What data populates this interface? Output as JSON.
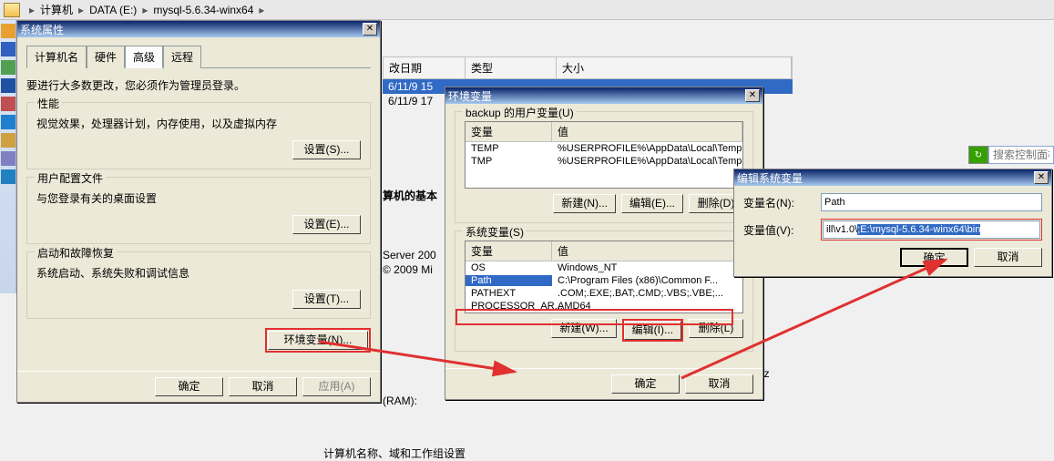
{
  "breadcrumb": {
    "parts": [
      "计算机",
      "DATA (E:)",
      "mysql-5.6.34-winx64"
    ],
    "arrow": "▸"
  },
  "search": {
    "placeholder": "搜索控制面板"
  },
  "bg": {
    "hdr_date": "改日期",
    "hdr_type": "类型",
    "hdr_size": "大小",
    "row1_date": "6/11/9 15",
    "row2_date": "6/11/9 17",
    "title": "算机的基本",
    "l1": "Server 200",
    "l2": "© 2009 Mi",
    "l3": "(RAM):",
    "hz": "Hz"
  },
  "sysprops": {
    "title": "系统属性",
    "tabs": {
      "computer": "计算机名",
      "hardware": "硬件",
      "advanced": "高级",
      "remote": "远程"
    },
    "note": "要进行大多数更改，您必须作为管理员登录。",
    "perf": {
      "legend": "性能",
      "desc": "视觉效果，处理器计划，内存使用，以及虚拟内存",
      "btn": "设置(S)..."
    },
    "profiles": {
      "legend": "用户配置文件",
      "desc": "与您登录有关的桌面设置",
      "btn": "设置(E)..."
    },
    "startup": {
      "legend": "启动和故障恢复",
      "desc": "系统启动、系统失败和调试信息",
      "btn": "设置(T)..."
    },
    "env_btn": "环境变量(N)...",
    "ok": "确定",
    "cancel": "取消",
    "apply": "应用(A)"
  },
  "env": {
    "title": "环境变量",
    "user_legend": "backup 的用户变量(U)",
    "col_var": "变量",
    "col_val": "值",
    "user_rows": [
      {
        "name": "TEMP",
        "value": "%USERPROFILE%\\AppData\\Local\\Temp"
      },
      {
        "name": "TMP",
        "value": "%USERPROFILE%\\AppData\\Local\\Temp"
      }
    ],
    "sys_legend": "系统变量(S)",
    "sys_rows": [
      {
        "name": "OS",
        "value": "Windows_NT"
      },
      {
        "name": "Path",
        "value": "C:\\Program Files (x86)\\Common F..."
      },
      {
        "name": "PATHEXT",
        "value": ".COM;.EXE;.BAT;.CMD;.VBS;.VBE;..."
      },
      {
        "name": "PROCESSOR_AR...",
        "value": "AMD64"
      }
    ],
    "new_btn_u": "新建(N)...",
    "edit_btn_u": "编辑(E)...",
    "del_btn_u": "删除(D)",
    "new_btn_s": "新建(W)...",
    "edit_btn_s": "编辑(I)...",
    "del_btn_s": "删除(L)",
    "ok": "确定",
    "cancel": "取消"
  },
  "edit": {
    "title": "编辑系统变量",
    "name_lbl": "变量名(N):",
    "name_val": "Path",
    "val_lbl": "变量值(V):",
    "val_pre": "ill\\v1.0\\",
    "val_sel": ";E:\\mysql-5.6.34-winx64\\bin",
    "ok": "确定",
    "cancel": "取消"
  },
  "footer": "计算机名称、域和工作组设置"
}
